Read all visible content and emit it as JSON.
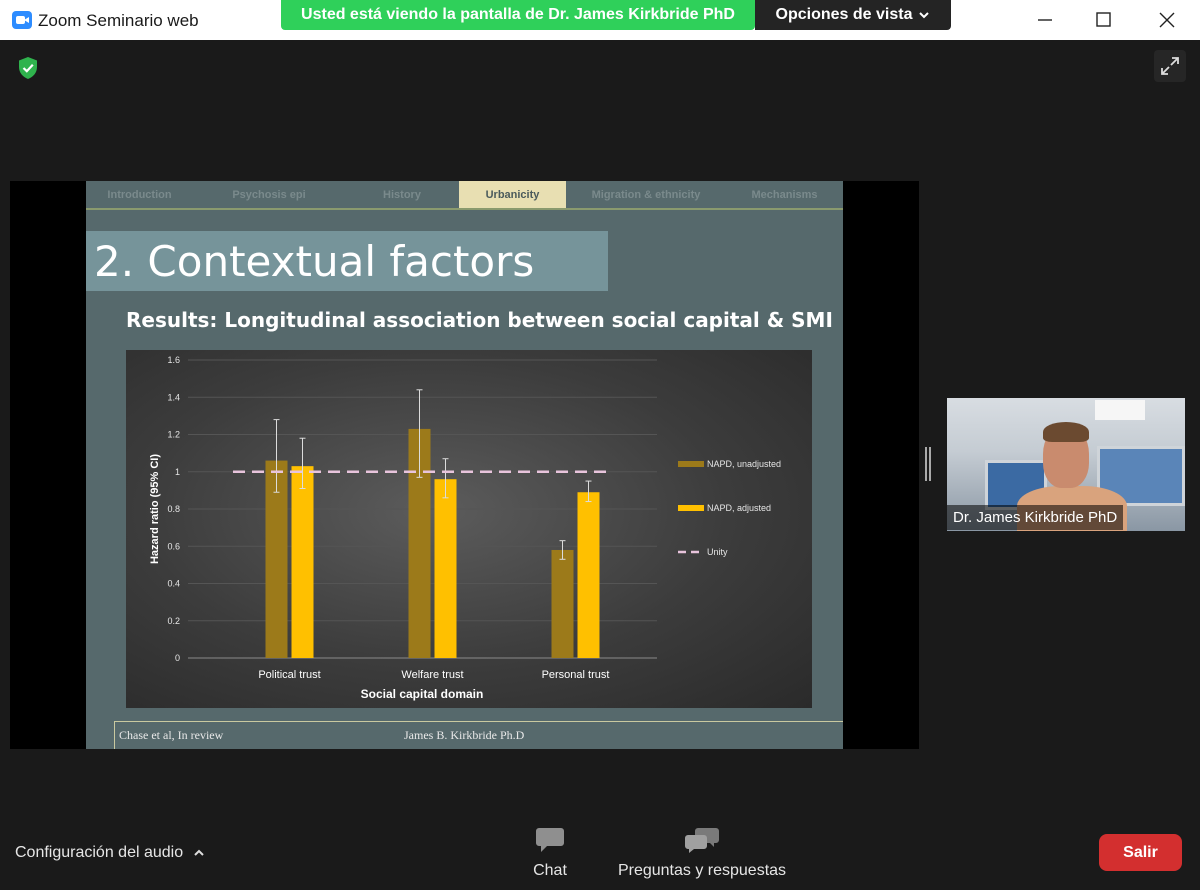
{
  "window": {
    "title": "Zoom Seminario web",
    "icons": {
      "app": "zoom-logo-icon",
      "minimize": "minimize-icon",
      "maximize": "maximize-icon",
      "close": "close-icon"
    }
  },
  "share_banner": {
    "text": "Usted está viendo la pantalla de Dr. James Kirkbride PhD",
    "view_options": "Opciones de vista",
    "color": "#2fd05a"
  },
  "slide": {
    "tabs": [
      {
        "label": "Introduction",
        "active": false
      },
      {
        "label": "Psychosis epi",
        "active": false
      },
      {
        "label": "History",
        "active": false
      },
      {
        "label": "Urbanicity",
        "active": true
      },
      {
        "label": "Migration & ethnicity",
        "active": false
      },
      {
        "label": "Mechanisms",
        "active": false
      }
    ],
    "heading": "2. Contextual factors",
    "subtitle": "Results: Longitudinal association between social capital & SMI",
    "footer_citation": "Chase et al, In review",
    "footer_author": "James B. Kirkbride Ph.D"
  },
  "chart_data": {
    "type": "bar",
    "xlabel": "Social capital domain",
    "ylabel": "Hazard ratio (95% CI)",
    "ylim": [
      0,
      1.6
    ],
    "yticks": [
      "0",
      "0.2",
      "0.4",
      "0.6",
      "0.8",
      "1",
      "1.2",
      "1.4",
      "1.6"
    ],
    "categories": [
      "Political trust",
      "Welfare trust",
      "Personal trust"
    ],
    "series": [
      {
        "name": "NAPD, unadjusted",
        "color": "#9c7a1a",
        "values": [
          1.06,
          1.23,
          0.58
        ],
        "ci_low": [
          0.89,
          0.97,
          0.53
        ],
        "ci_high": [
          1.28,
          1.44,
          0.63
        ]
      },
      {
        "name": "NAPD, adjusted",
        "color": "#ffc000",
        "values": [
          1.03,
          0.96,
          0.89
        ],
        "ci_low": [
          0.91,
          0.86,
          0.84
        ],
        "ci_high": [
          1.18,
          1.07,
          0.95
        ]
      }
    ],
    "reference_line": {
      "name": "Unity",
      "value": 1,
      "color": "#e8c4dc"
    },
    "legend_position": "right",
    "grid": true
  },
  "speaker": {
    "name": "Dr. James Kirkbride PhD"
  },
  "toolbar": {
    "audio_settings": "Configuración del audio",
    "chat": "Chat",
    "qa": "Preguntas y respuestas",
    "leave": "Salir",
    "leave_color": "#d32f2f"
  }
}
